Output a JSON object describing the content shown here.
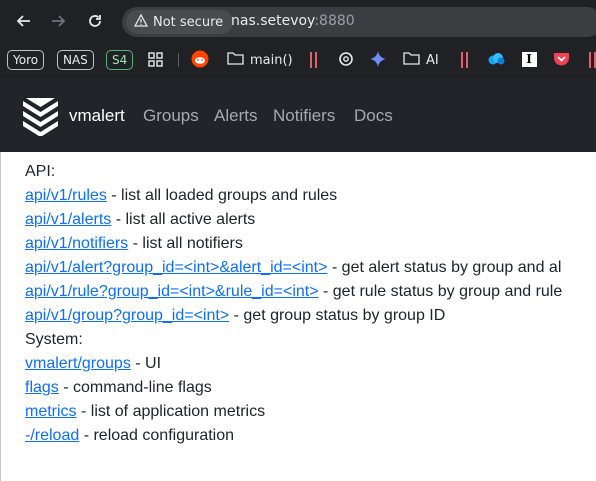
{
  "browser": {
    "security_label": "Not secure",
    "url_host": "nas.setevoy",
    "url_port": ":8880",
    "bookmarks": {
      "yoro": "Yoro",
      "nas": "NAS",
      "s4": "S4",
      "folder_main": "main()",
      "folder_ai": "AI",
      "instapaper": "I"
    }
  },
  "navbar": {
    "brand": "vmalert",
    "links": [
      "Groups",
      "Alerts",
      "Notifiers",
      "Docs"
    ]
  },
  "content": {
    "api_heading": "API:",
    "api_items": [
      {
        "link": "api/v1/rules",
        "desc": " - list all loaded groups and rules"
      },
      {
        "link": "api/v1/alerts",
        "desc": " - list all active alerts"
      },
      {
        "link": "api/v1/notifiers",
        "desc": " - list all notifiers"
      },
      {
        "link": "api/v1/alert?group_id=<int>&alert_id=<int>",
        "desc": " - get alert status by group and al"
      },
      {
        "link": "api/v1/rule?group_id=<int>&rule_id=<int>",
        "desc": " - get rule status by group and rule"
      },
      {
        "link": "api/v1/group?group_id=<int>",
        "desc": " - get group status by group ID"
      }
    ],
    "system_heading": "System:",
    "system_items": [
      {
        "link": "vmalert/groups",
        "desc": " - UI"
      },
      {
        "link": "flags",
        "desc": " - command-line flags"
      },
      {
        "link": "metrics",
        "desc": " - list of application metrics"
      },
      {
        "link": "-/reload",
        "desc": " - reload configuration"
      }
    ]
  }
}
